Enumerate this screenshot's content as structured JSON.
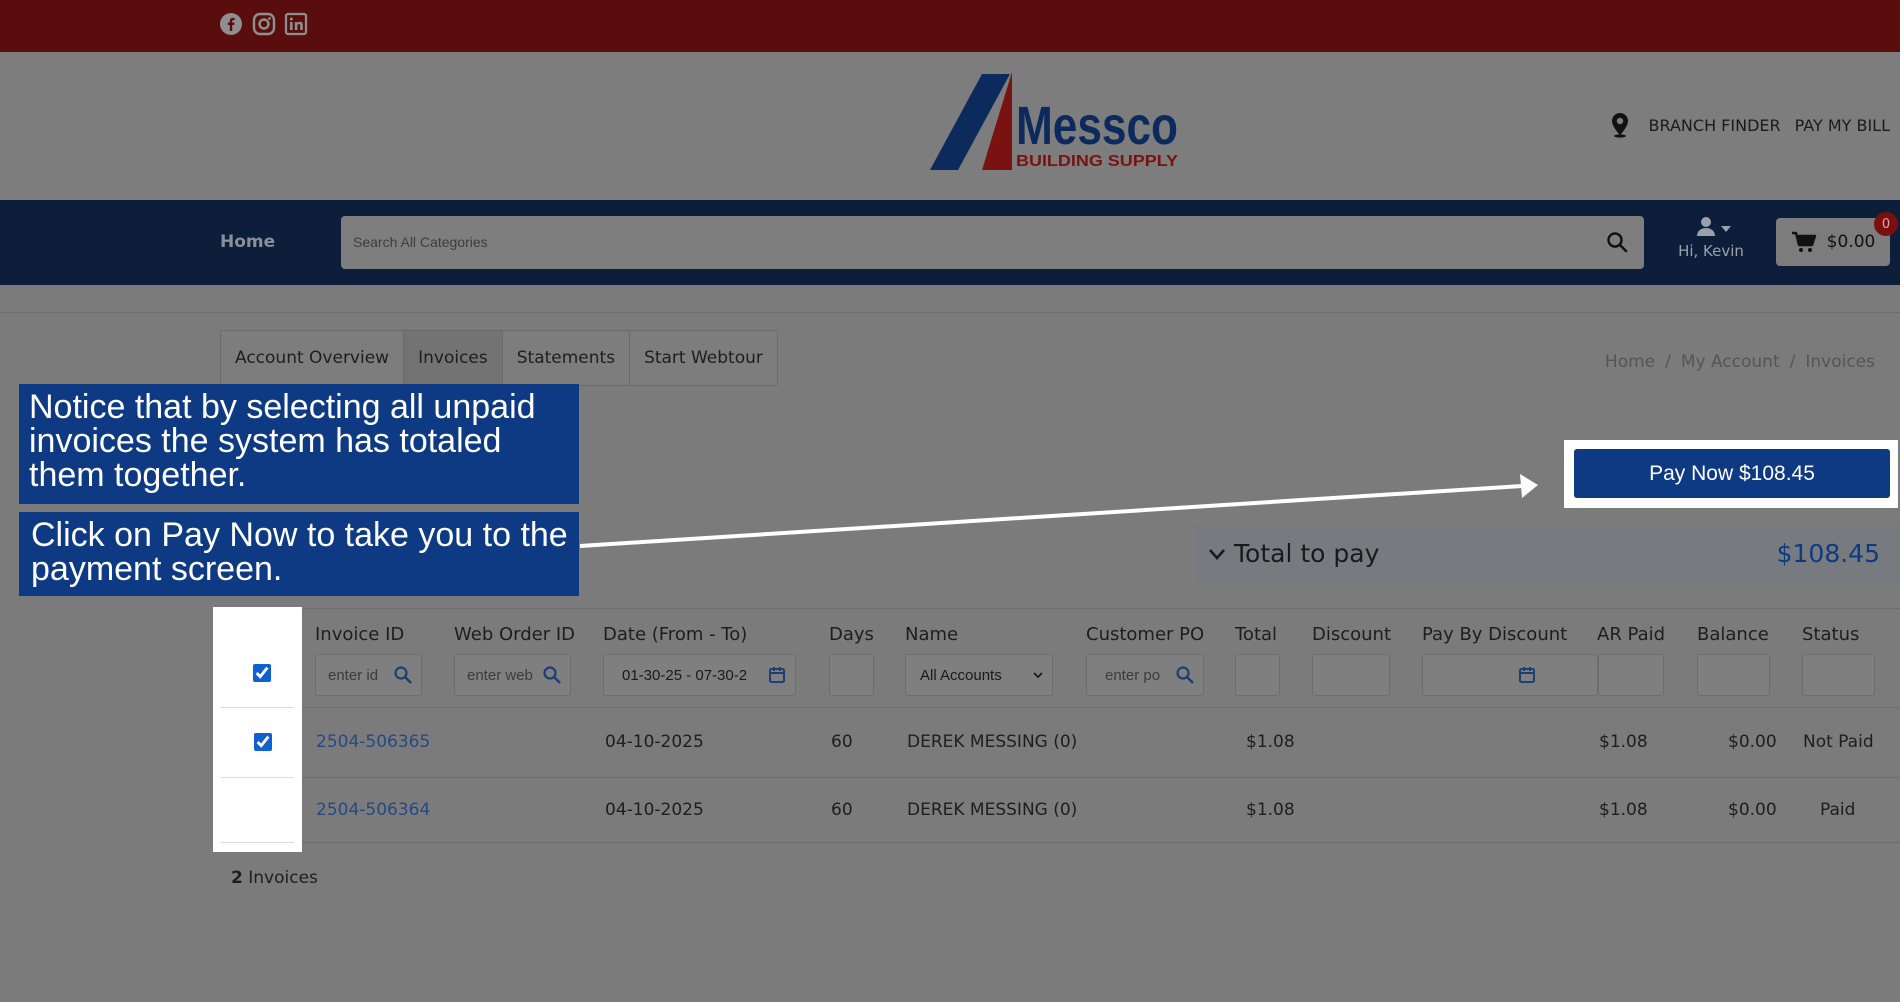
{
  "social": [
    "facebook-icon",
    "instagram-icon",
    "linkedin-icon"
  ],
  "logo": {
    "primary": "Messco",
    "secondary": "BUILDING SUPPLY"
  },
  "header_links": {
    "branch_finder": "BRANCH FINDER",
    "pay_bill": "PAY MY BILL"
  },
  "nav": {
    "home": "Home",
    "search_placeholder": "Search All Categories",
    "greeting": "Hi, Kevin",
    "cart_total": "$0.00",
    "cart_count": "0"
  },
  "tabs": [
    "Account Overview",
    "Invoices",
    "Statements",
    "Start Webtour"
  ],
  "breadcrumb": {
    "home": "Home",
    "sep1": "/",
    "account": "My Account",
    "sep2": "/",
    "current": "Invoices"
  },
  "pay_now": "Pay Now $108.45",
  "total": {
    "label": "Total to pay",
    "amount": "$108.45"
  },
  "table": {
    "headers": [
      "Invoice ID",
      "Web Order ID",
      "Date (From - To)",
      "Days",
      "Name",
      "Customer PO",
      "Total",
      "Discount",
      "Pay By Discount",
      "AR Paid",
      "Balance",
      "Status"
    ],
    "filters": {
      "invoice_id_placeholder": "enter id",
      "web_order_placeholder": "enter web",
      "date_range": "01-30-25 - 07-30-2",
      "name_select": "All Accounts",
      "po_placeholder": "enter po"
    },
    "rows": [
      {
        "invoice": "2504-506365",
        "date": "04-10-2025",
        "days": "60",
        "name": "DEREK MESSING (0)",
        "total": "$1.08",
        "ar_paid": "$1.08",
        "balance": "$0.00",
        "status": "Not Paid",
        "checked": true
      },
      {
        "invoice": "2504-506364",
        "date": "04-10-2025",
        "days": "60",
        "name": "DEREK MESSING (0)",
        "total": "$1.08",
        "ar_paid": "$1.08",
        "balance": "$0.00",
        "status": "Paid",
        "checked": false
      }
    ],
    "count_number": "2",
    "count_label": "Invoices"
  },
  "callouts": {
    "first": "Notice that by selecting all unpaid invoices the system has totaled them together.",
    "second": "Click on Pay Now to take you to the payment screen."
  },
  "colors": {
    "topbar": "#5a0d0d",
    "nav": "#0c1e3a",
    "accent": "#0d3a82",
    "link": "#244a86"
  }
}
